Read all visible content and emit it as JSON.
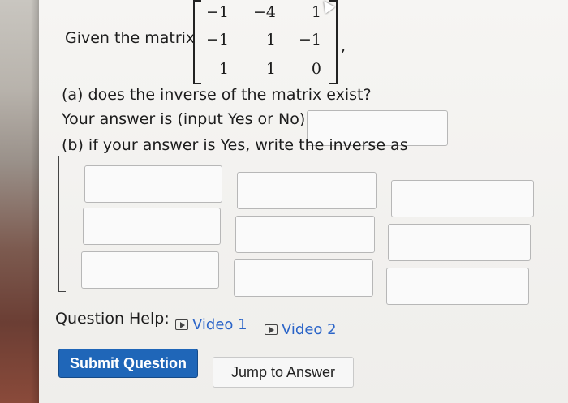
{
  "question": {
    "intro": "Given the matrix",
    "matrix": [
      [
        "−1",
        "−4",
        "1"
      ],
      [
        "−1",
        "1",
        "−1"
      ],
      [
        "1",
        "1",
        "0"
      ]
    ],
    "trailing_comma": ",",
    "part_a": "(a) does the inverse of the matrix exist?",
    "answer_prompt": "Your answer is (input Yes or No):",
    "answer_value": "",
    "part_b": "(b) if your answer is Yes, write the inverse as"
  },
  "inverse_inputs": [
    [
      "",
      "",
      ""
    ],
    [
      "",
      "",
      ""
    ],
    [
      "",
      "",
      ""
    ]
  ],
  "help": {
    "label": "Question Help:",
    "video1": "Video 1",
    "video2": "Video 2",
    "video1_icon": "play-video-icon",
    "video2_icon": "play-video-icon"
  },
  "buttons": {
    "submit": "Submit Question",
    "jump": "Jump to Answer"
  },
  "colors": {
    "submit_bg": "#1f66b8",
    "link": "#2a64c8"
  }
}
